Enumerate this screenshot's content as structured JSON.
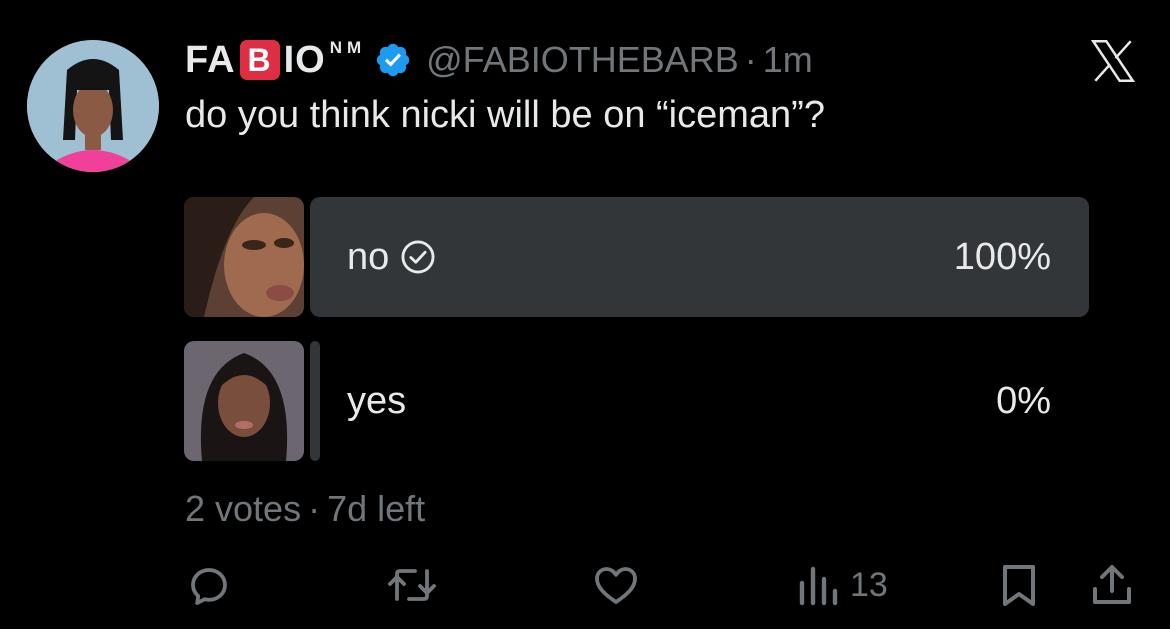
{
  "author": {
    "name_prefix": "FA",
    "name_emoji": "B",
    "name_suffix": "IO",
    "name_superscript": "NM",
    "handle": "@FABIOTHEBARB",
    "separator": "·",
    "time": "1m"
  },
  "tweet": {
    "text": "do you think nicki will be on “iceman”?"
  },
  "poll": {
    "options": [
      {
        "label": "no",
        "percent_label": "100%",
        "percent": 100,
        "selected": true
      },
      {
        "label": "yes",
        "percent_label": "0%",
        "percent": 0,
        "selected": false
      }
    ],
    "votes": "2 votes",
    "separator": "·",
    "time_left": "7d left"
  },
  "actions": {
    "views_count": "13"
  },
  "colors": {
    "background": "#000000",
    "text_primary": "#e7e9ea",
    "text_secondary": "#71767b",
    "poll_bar": "#333639",
    "verified_blue": "#1d9bf0",
    "emoji_red": "#dd2e44"
  },
  "icons": [
    "verified-badge-icon",
    "x-logo-icon",
    "check-circle-icon",
    "reply-icon",
    "repost-icon",
    "like-icon",
    "views-icon",
    "bookmark-icon",
    "share-icon"
  ]
}
